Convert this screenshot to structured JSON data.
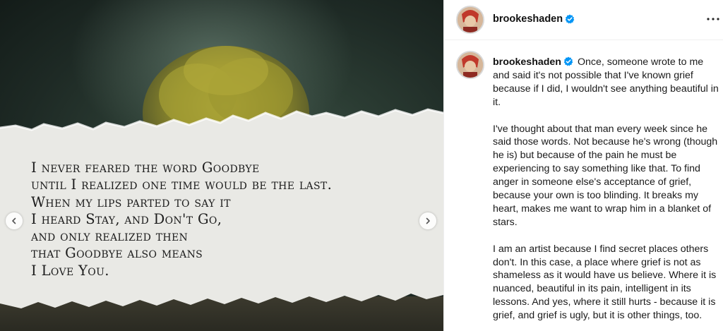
{
  "post": {
    "username": "brookeshaden",
    "verified": true,
    "more_icon": "more-horizontal-icon"
  },
  "media": {
    "poem_lines": [
      "I never feared the word Goodbye",
      "until I realized one time would be the last.",
      "When my lips parted to say it",
      "I heard Stay, and Don't Go,",
      "and only realized then",
      "that Goodbye also means",
      "I Love You."
    ],
    "prev_icon": "chevron-left-icon",
    "next_icon": "chevron-right-icon"
  },
  "caption": {
    "first_text": "Once, someone wrote to me and said it's not possible that I've known grief because if I did, I wouldn't see anything beautiful in it.",
    "paragraph_2": "I've thought about that man every week since he said those words. Not because he's wrong (though he is) but because of the pain he must be experiencing to say something like that. To find anger in someone else's acceptance of grief, because your own is too blinding. It breaks my heart, makes me want to wrap him in a blanket of stars.",
    "paragraph_3": "I am an artist because I find secret places others don't. In this case, a place where grief is not as shameless as it would have us believe. Where it is nuanced, beautiful in its pain, intelligent in its lessons. And yes, where it still hurts - because it is grief, and grief is ugly, but it is other things, too."
  },
  "colors": {
    "verified_badge": "#0095f6",
    "text_primary": "#111111",
    "border": "#efefef"
  }
}
